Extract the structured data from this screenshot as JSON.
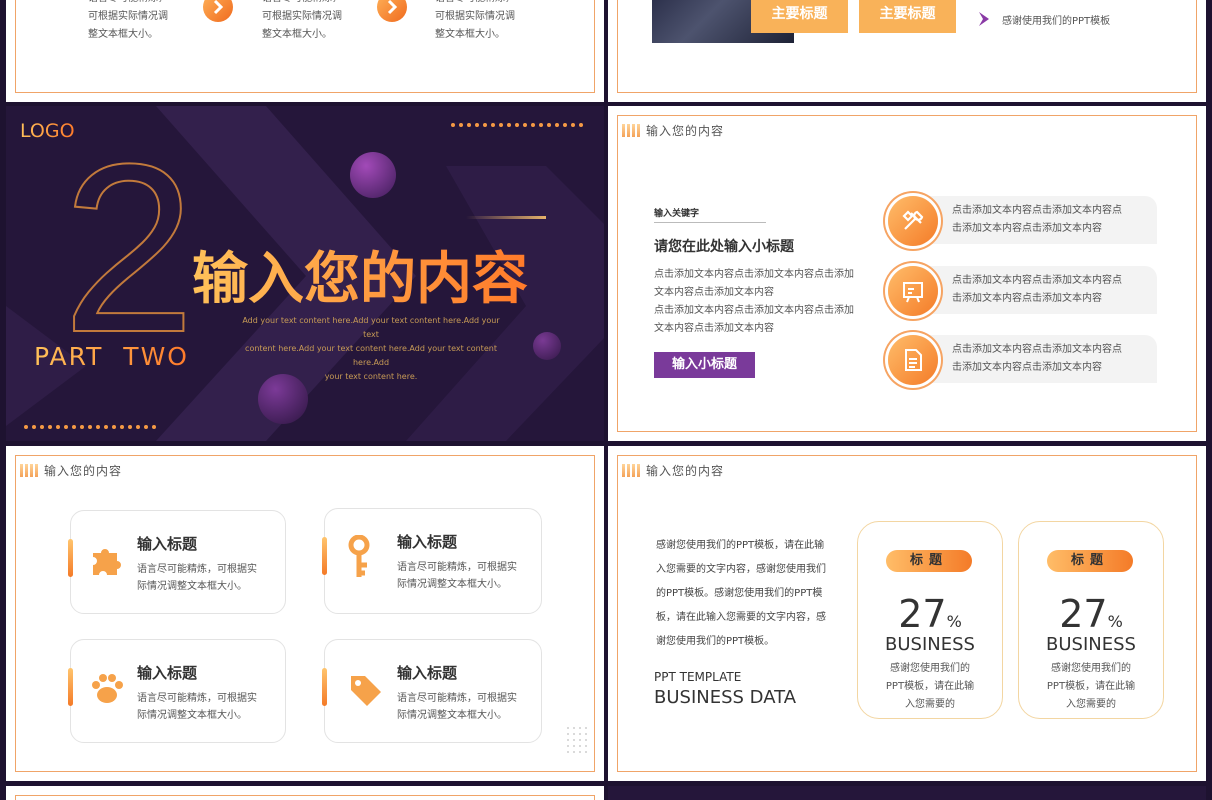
{
  "slide1": {
    "columns": [
      {
        "desc": [
          "语言尽可能精炼，",
          "可根据实际情况调",
          "整文本框大小。"
        ]
      },
      {
        "desc": [
          "语言尽可能精炼，",
          "可根据实际情况调",
          "整文本框大小。"
        ]
      },
      {
        "desc": [
          "语言尽可能精炼，",
          "可根据实际情况调",
          "整文本框大小。"
        ]
      }
    ],
    "arrow_icon": "chevron-right-icon"
  },
  "slide2": {
    "buttons": [
      "主要标题",
      "主要标题"
    ],
    "note": "感谢使用我们的PPT模板"
  },
  "slide3": {
    "logo": "LOGO",
    "number": "2",
    "title": "输入您的内容",
    "part": "PART  TWO",
    "subtitle": [
      "Add your text content here.Add your text content here.Add your text",
      "content here.Add your text content here.Add your text content here.Add",
      "your text content here."
    ]
  },
  "slide4": {
    "header": "输入您的内容",
    "keyword": "输入关键字",
    "subtitle": "请您在此处输入小标题",
    "body": [
      "点击添加文本内容点击添加文本内容点击添加",
      "文本内容点击添加文本内容",
      "点击添加文本内容点击添加文本内容点击添加",
      "文本内容点击添加文本内容"
    ],
    "button": "输入小标题",
    "items": [
      {
        "icon": "tools-icon",
        "text": [
          "点击添加文本内容点击添加文本内容点",
          "击添加文本内容点击添加文本内容"
        ]
      },
      {
        "icon": "board-icon",
        "text": [
          "点击添加文本内容点击添加文本内容点",
          "击添加文本内容点击添加文本内容"
        ]
      },
      {
        "icon": "document-icon",
        "text": [
          "点击添加文本内容点击添加文本内容点",
          "击添加文本内容点击添加文本内容"
        ]
      }
    ]
  },
  "slide5": {
    "header": "输入您的内容",
    "cards": [
      {
        "icon": "puzzle-icon",
        "title": "输入标题",
        "desc": [
          "语言尽可能精炼，可根据实",
          "际情况调整文本框大小。"
        ]
      },
      {
        "icon": "key-icon",
        "title": "输入标题",
        "desc": [
          "语言尽可能精炼，可根据实",
          "际情况调整文本框大小。"
        ]
      },
      {
        "icon": "paw-icon",
        "title": "输入标题",
        "desc": [
          "语言尽可能精炼，可根据实",
          "际情况调整文本框大小。"
        ]
      },
      {
        "icon": "tag-icon",
        "title": "输入标题",
        "desc": [
          "语言尽可能精炼，可根据实",
          "际情况调整文本框大小。"
        ]
      }
    ]
  },
  "slide6": {
    "header": "输入您的内容",
    "body": [
      "感谢您使用我们的PPT模板，请在此输",
      "入您需要的文字内容，感谢您使用我们",
      "的PPT模板。感谢您使用我们的PPT模",
      "板，请在此输入您需要的文字内容，感",
      "谢您使用我们的PPT模板。"
    ],
    "template_label": "PPT TEMPLATE",
    "data_label": "BUSINESS DATA",
    "stats": [
      {
        "label": "标题",
        "value": "27",
        "unit": "%",
        "word": "BUSINESS",
        "desc": [
          "感谢您使用我们的",
          "PPT模板，请在此输",
          "入您需要的"
        ]
      },
      {
        "label": "标题",
        "value": "27",
        "unit": "%",
        "word": "BUSINESS",
        "desc": [
          "感谢您使用我们的",
          "PPT模板，请在此输",
          "入您需要的"
        ]
      }
    ]
  },
  "colors": {
    "accent": "#f47b28",
    "accent_light": "#ffbd6a",
    "purple": "#7a3a9a",
    "dark": "#1e1230"
  }
}
